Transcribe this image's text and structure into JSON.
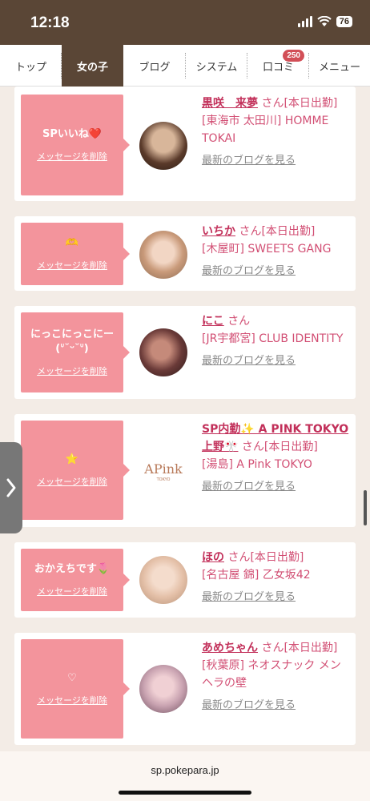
{
  "status": {
    "time": "12:18",
    "battery": "76"
  },
  "nav": {
    "tabs": [
      {
        "label": "トップ"
      },
      {
        "label": "女の子",
        "active": true
      },
      {
        "label": "ブログ"
      },
      {
        "label": "システム"
      },
      {
        "label": "口コミ",
        "badge": "250"
      },
      {
        "label": "メニュー"
      }
    ]
  },
  "cards": [
    {
      "message": "SPいいね❤️",
      "delete_label": "メッセージを削除",
      "name": "黒咲　来夢",
      "suffix": "さん[本日出勤]",
      "location": "[東海市 太田川] HOMME TOKAI",
      "blog_link": "最新のブログを見る"
    },
    {
      "message": "🫶",
      "delete_label": "メッセージを削除",
      "name": "いちか",
      "suffix": "さん[本日出勤]",
      "location": "[木屋町] SWEETS GANG",
      "blog_link": "最新のブログを見る"
    },
    {
      "message": "にっこにっこにー(ᐡ˘ᵕ˘ᐡ)",
      "delete_label": "メッセージを削除",
      "name": "にこ",
      "suffix": "さん",
      "location": "[JR宇都宮] CLUB IDENTITY",
      "blog_link": "最新のブログを見る"
    },
    {
      "message": "⭐",
      "delete_label": "メッセージを削除",
      "name": "SP内勤✨ A PINK TOKYO上野🎌",
      "suffix": "さん[本日出勤]",
      "location": "[湯島] A Pink TOKYO",
      "blog_link": "最新のブログを見る"
    },
    {
      "message": "おかえちです🌷",
      "delete_label": "メッセージを削除",
      "name": "ほの",
      "suffix": "さん[本日出勤]",
      "location": "[名古屋 錦] 乙女坂42",
      "blog_link": "最新のブログを見る"
    },
    {
      "message": "♡",
      "delete_label": "メッセージを削除",
      "name": "あめちゃん",
      "suffix": "さん[本日出勤]",
      "location": "[秋葉原] ネオスナック メンヘラの壁",
      "blog_link": "最新のブログを見る"
    }
  ],
  "url": "sp.pokepara.jp",
  "colors": {
    "header_brown": "#5a4636",
    "message_pink": "#f3949c",
    "name_pink": "#c2305a"
  }
}
